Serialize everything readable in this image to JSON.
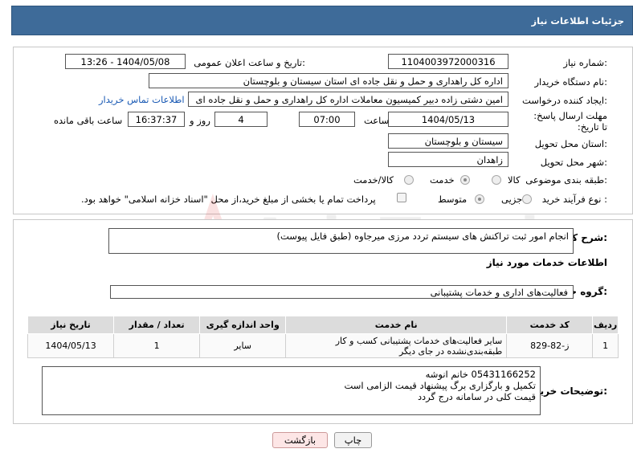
{
  "header": {
    "title": "جزئیات اطلاعات نیاز"
  },
  "form": {
    "need_number": {
      "label": "شماره نیاز:",
      "value": "1104003972000316"
    },
    "announce_datetime": {
      "label": "تاریخ و ساعت اعلان عمومی:",
      "value": "1404/05/08 - 13:26"
    },
    "buyer_org": {
      "label": "نام دستگاه خریدار:",
      "value": "اداره کل راهداری و حمل و نقل جاده ای استان سیستان و بلوچستان"
    },
    "requester": {
      "label": "ایجاد کننده درخواست:",
      "value": "امین دشتی زاده دبیر کمیسیون معاملات اداره کل راهداری و حمل و نقل جاده ای",
      "contact_link": "اطلاعات تماس خریدار"
    },
    "deadline": {
      "label": "مهلت ارسال پاسخ: تا تاریخ:",
      "date": "1404/05/13",
      "time_label": "ساعت",
      "time": "07:00",
      "days": "4",
      "days_label": "روز و",
      "remaining": "16:37:37",
      "remaining_label": "ساعت باقی مانده"
    },
    "province": {
      "label": "استان محل تحویل:",
      "value": "سیستان و بلوچستان"
    },
    "city": {
      "label": "شهر محل تحویل:",
      "value": "زاهدان"
    },
    "category": {
      "label": "طبقه بندی موضوعی:",
      "options": [
        "کالا",
        "خدمت",
        "کالا/خدمت"
      ],
      "selected": "خدمت"
    },
    "purchase_type": {
      "label": "نوع فرآیند خرید :",
      "options": [
        "جزیی",
        "متوسط"
      ],
      "selected": "متوسط",
      "payment_note": "پرداخت تمام یا بخشی از مبلغ خرید،از محل \"اسناد خزانه اسلامی\" خواهد بود."
    }
  },
  "summary": {
    "label": "شرح کلی نیاز:",
    "value": "انجام امور ثبت تراکنش های سیستم تردد مرزی میرجاوه (طبق فایل پیوست)"
  },
  "services": {
    "section_title": "اطلاعات خدمات مورد نیاز",
    "group_label": "گروه خدمت:",
    "group_value": "فعالیت‌های اداری و خدمات پشتیبانی",
    "table": {
      "headers": [
        "ردیف",
        "کد خدمت",
        "نام خدمت",
        "واحد اندازه گیری",
        "تعداد / مقدار",
        "تاریخ نیاز"
      ],
      "rows": [
        [
          "1",
          "ز-82-829",
          "سایر فعالیت‌های خدمات پشتیبانی کسب و کار طبقه‌بندی‌نشده در جای دیگر",
          "سایر",
          "1",
          "1404/05/13"
        ]
      ]
    }
  },
  "buyer_notes": {
    "label": "توضیحات خریدار:",
    "lines": [
      "05431166252 خانم انوشه",
      "تکمیل و بارگزاری برگ پیشنهاد قیمت الزامی است",
      "قیمت کلی در سامانه درج گردد"
    ]
  },
  "buttons": {
    "print": "چاپ",
    "back": "بازگشت"
  },
  "watermark": {
    "text": "AriaTender.neT"
  },
  "colors": {
    "header_bg": "#3e6b99",
    "link": "#1a5ab4",
    "back_button_bg": "#fde6e6"
  }
}
